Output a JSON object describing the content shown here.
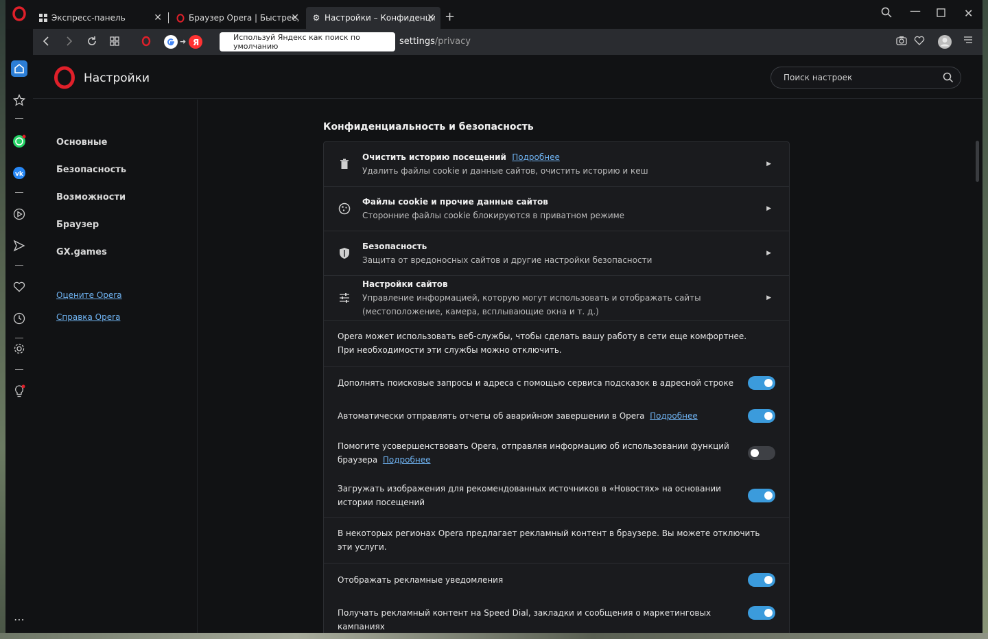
{
  "tabs": [
    {
      "label": "Экспресс-панель",
      "icon": "grid-icon"
    },
    {
      "label": "Браузер Opera | Быстрее, ",
      "icon": "opera-icon"
    },
    {
      "label": "Настройки – Конфиденци",
      "icon": "gear-icon",
      "active": true
    }
  ],
  "addressbar": {
    "suggest_text": "Используй Яндекс как поиск по умолчанию",
    "url_main": "settings",
    "url_path": "/privacy"
  },
  "page": {
    "title": "Настройки",
    "search_placeholder": "Поиск настроек"
  },
  "nav": {
    "items": [
      "Основные",
      "Безопасность",
      "Возможности",
      "Браузер",
      "GX.games"
    ],
    "links": [
      "Оцените Opera",
      "Справка Opera"
    ]
  },
  "section_title": "Конфиденциальность и безопасность",
  "rows": [
    {
      "title": "Очистить историю посещений",
      "link": "Подробнее",
      "desc": "Удалить файлы cookie и данные сайтов, очистить историю и кеш",
      "icon": "trash-icon"
    },
    {
      "title": "Файлы cookie и прочие данные сайтов",
      "desc": "Сторонние файлы cookie блокируются в приватном режиме",
      "icon": "cookie-icon"
    },
    {
      "title": "Безопасность",
      "desc": "Защита от вредоносных сайтов и другие настройки безопасности",
      "icon": "shield-icon"
    },
    {
      "title": "Настройки сайтов",
      "desc": "Управление информацией, которую могут использовать и отображать сайты",
      "desc2": "(местоположение, камера, всплывающие окна и т. д.)",
      "icon": "sliders-icon"
    }
  ],
  "info1": "Opera может использовать веб-службы, чтобы сделать вашу работу в сети еще комфортнее. При необходимости эти службы можно отключить.",
  "toggles1": [
    {
      "label": "Дополнять поисковые запросы и адреса с помощью сервиса подсказок в адресной строке",
      "on": true
    },
    {
      "label": "Автоматически отправлять отчеты об аварийном завершении в Opera",
      "link": "Подробнее",
      "on": true
    },
    {
      "label": "Помогите усовершенствовать Opera, отправляя информацию об использовании функций браузера",
      "link": "Подробнее",
      "on": false
    },
    {
      "label": "Загружать изображения для рекомендованных источников в «Новостях» на основании истории посещений",
      "on": true
    }
  ],
  "info2": "В некоторых регионах Opera предлагает рекламный контент в браузере. Вы можете отключить эти услуги.",
  "toggles2": [
    {
      "label": "Отображать рекламные уведомления",
      "on": true
    },
    {
      "label": "Получать рекламный контент на Speed Dial, закладки и сообщения о маркетинговых кампаниях",
      "on": true
    }
  ],
  "colors": {
    "accent": "#3b9bdc",
    "link": "#6fb3f2",
    "opera_red": "#e0202a",
    "background": "#111214"
  }
}
